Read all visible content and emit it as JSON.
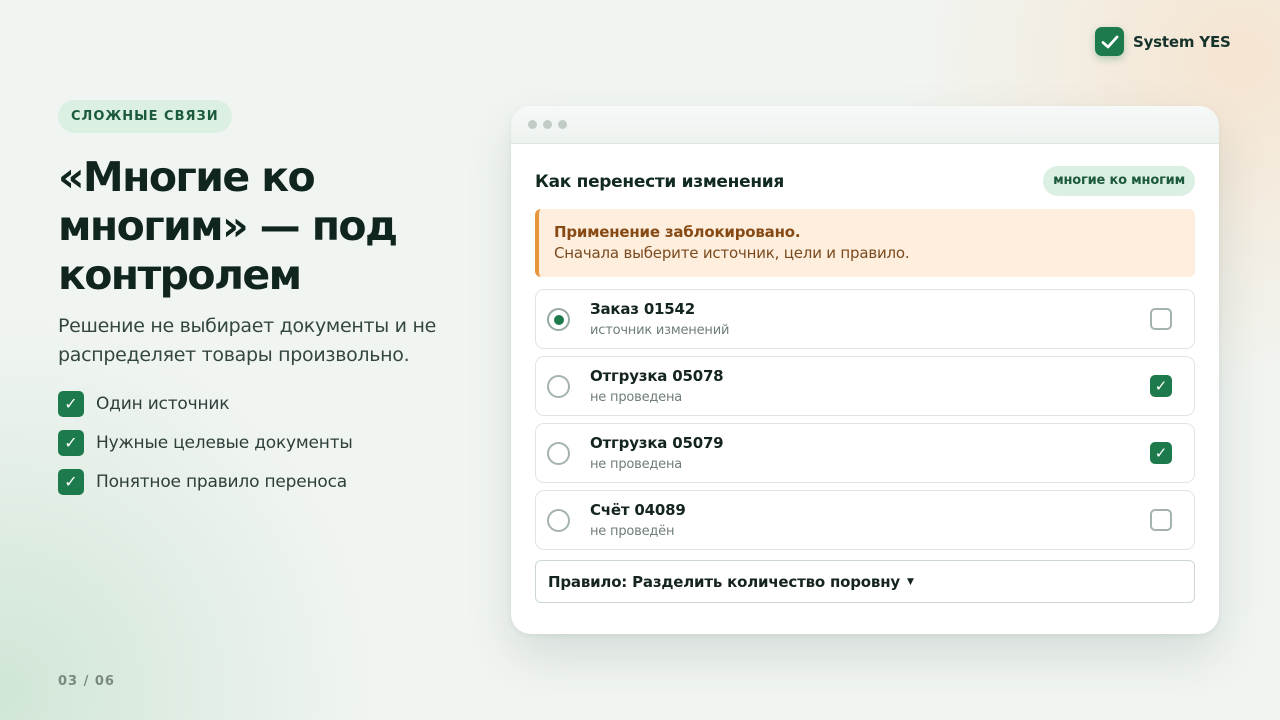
{
  "brand": {
    "name": "System YES",
    "icon": "check-icon"
  },
  "slide": {
    "kicker": "СЛОЖНЫЕ СВЯЗИ",
    "headline": "«Многие ко многим» — под контролем",
    "subtitle": "Решение не выбирает документы и не распределяет товары произвольно.",
    "points": [
      {
        "icon": "check-icon",
        "label": "Один источник"
      },
      {
        "icon": "check-icon",
        "label": "Нужные целевые документы"
      },
      {
        "icon": "check-icon",
        "label": "Понятное правило переноса"
      }
    ],
    "page_counter": "03 / 06"
  },
  "window": {
    "title": "Как перенести изменения",
    "mode_badge": "многие ко многим",
    "alert": {
      "title": "Применение заблокировано.",
      "text": "Сначала выберите источник, цели и правило."
    },
    "documents": [
      {
        "name": "Заказ 01542",
        "status": "источник изменений",
        "source_selected": true,
        "target_checked": false
      },
      {
        "name": "Отгрузка 05078",
        "status": "не проведена",
        "source_selected": false,
        "target_checked": true
      },
      {
        "name": "Отгрузка 05079",
        "status": "не проведена",
        "source_selected": false,
        "target_checked": true
      },
      {
        "name": "Счёт 04089",
        "status": "не проведён",
        "source_selected": false,
        "target_checked": false
      }
    ],
    "rule_select": {
      "label": "Правило: Разделить количество поровну",
      "icon": "caret-down-icon"
    }
  },
  "colors": {
    "accent": "#1d7a4c",
    "warning_border": "#e8963c",
    "warning_bg": "#fdeedd",
    "badge_bg": "#dcefe3"
  }
}
